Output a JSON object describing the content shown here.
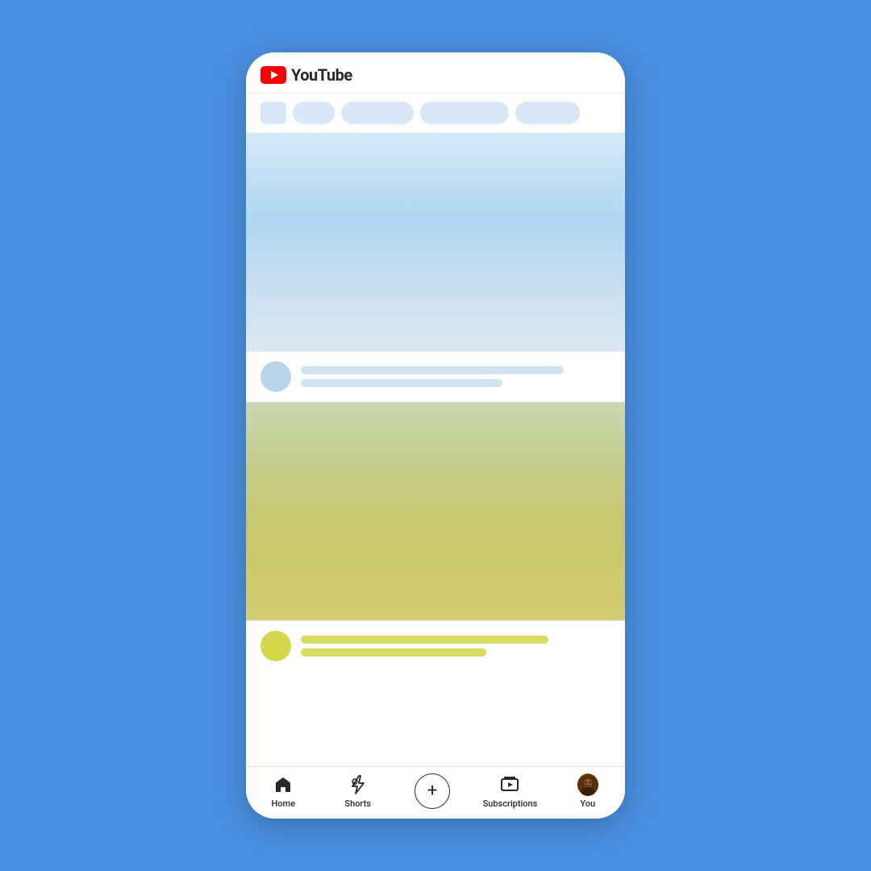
{
  "app": {
    "name": "YouTube",
    "logo_text": "YouTube"
  },
  "header": {
    "logo_alt": "YouTube logo"
  },
  "filter_chips": {
    "chips": [
      {
        "label": "",
        "type": "square"
      },
      {
        "label": "",
        "type": "circle"
      },
      {
        "label": "",
        "type": "medium"
      },
      {
        "label": "",
        "type": "large"
      },
      {
        "label": "",
        "type": "xl"
      }
    ]
  },
  "video_cards": [
    {
      "thumbnail_color": "blue",
      "channel_name": "",
      "title_line1": "",
      "title_line2": ""
    },
    {
      "thumbnail_color": "green",
      "channel_name": "",
      "title_line1": "",
      "title_line2": ""
    }
  ],
  "bottom_nav": {
    "items": [
      {
        "id": "home",
        "label": "Home",
        "icon": "home-icon"
      },
      {
        "id": "shorts",
        "label": "Shorts",
        "icon": "shorts-icon"
      },
      {
        "id": "create",
        "label": "",
        "icon": "create-icon"
      },
      {
        "id": "subscriptions",
        "label": "Subscriptions",
        "icon": "subscriptions-icon"
      },
      {
        "id": "you",
        "label": "You",
        "icon": "profile-icon"
      }
    ]
  }
}
